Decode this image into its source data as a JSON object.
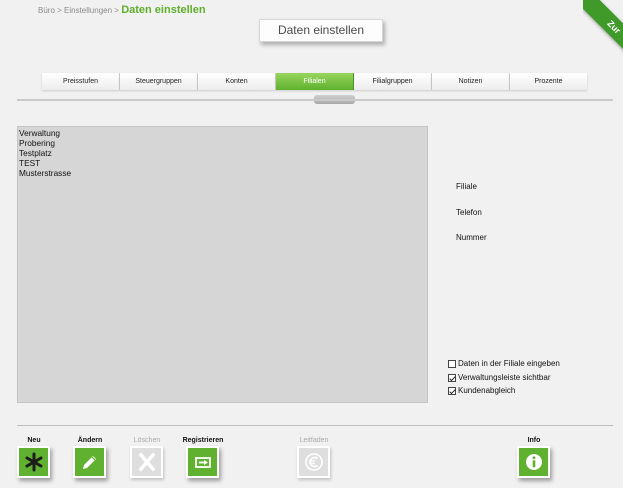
{
  "breadcrumb": {
    "trail": "Büro > Einstellungen >",
    "current": "Daten einstellen"
  },
  "page_title": "Daten einstellen",
  "corner_ribbon": {
    "label": "Zur"
  },
  "tabs": [
    {
      "label": "Preisstufen",
      "active": false
    },
    {
      "label": "Steuergruppen",
      "active": false
    },
    {
      "label": "Konten",
      "active": false
    },
    {
      "label": "Filialen",
      "active": true
    },
    {
      "label": "Filialgruppen",
      "active": false
    },
    {
      "label": "Notizen",
      "active": false
    },
    {
      "label": "Prozente",
      "active": false
    }
  ],
  "branch_list": {
    "items": [
      "Verwaltung",
      "Probering",
      "Testplatz",
      "TEST",
      "Musterstrasse"
    ]
  },
  "detail_fields": {
    "filiale_label": "Filiale",
    "telefon_label": "Telefon",
    "nummer_label": "Nummer"
  },
  "options": [
    {
      "label": "Daten in der Filiale eingeben",
      "checked": false
    },
    {
      "label": "Verwaltungsleiste sichtbar",
      "checked": true
    },
    {
      "label": "Kundenabgleich",
      "checked": true
    }
  ],
  "toolbar": {
    "new_label": "Neu",
    "edit_label": "Ändern",
    "delete_label": "Löschen",
    "register_label": "Registrieren",
    "guide_label": "Leitfaden",
    "info_label": "Info"
  },
  "colors": {
    "accent_green": "#5fb12f",
    "ribbon_green": "#3f9a2a",
    "list_background": "#d6d6d6"
  },
  "icons": {
    "new": "asterisk-icon",
    "edit": "pencil-icon",
    "delete": "x-icon",
    "register": "register-icon",
    "guide": "euro-icon",
    "info": "info-icon"
  }
}
